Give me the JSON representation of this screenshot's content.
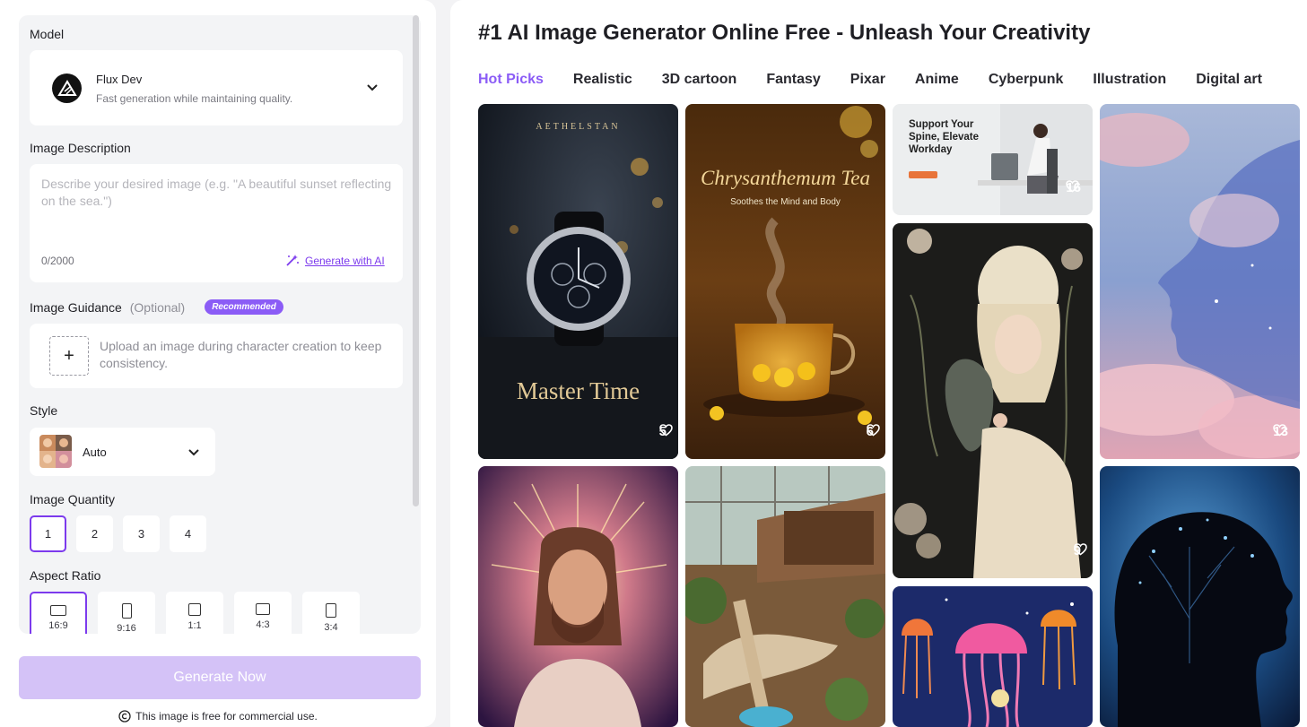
{
  "sidebar": {
    "model_label": "Model",
    "model": {
      "name": "Flux Dev",
      "description": "Fast generation while maintaining quality.",
      "icon": "flux-logo"
    },
    "description_label": "Image Description",
    "description": {
      "placeholder": "Describe your desired image (e.g. \"A beautiful sunset reflecting on the sea.\")",
      "value": "",
      "count": "0/2000",
      "generate_ai_label": "Generate with AI"
    },
    "guidance": {
      "label": "Image Guidance",
      "optional": "(Optional)",
      "badge": "Recommended",
      "upload_text": "Upload an image during character creation to keep consistency."
    },
    "style": {
      "label": "Style",
      "value": "Auto"
    },
    "quantity": {
      "label": "Image Quantity",
      "options": [
        "1",
        "2",
        "3",
        "4"
      ],
      "selected": "1"
    },
    "aspect": {
      "label": "Aspect Ratio",
      "options": [
        "16:9",
        "9:16",
        "1:1",
        "4:3",
        "3:4"
      ],
      "selected": "16:9"
    },
    "generate_button": "Generate Now",
    "free_note": "This image is free for commercial use."
  },
  "main": {
    "title": "#1 AI Image Generator Online Free - Unleash Your Creativity",
    "tabs": [
      "Hot Picks",
      "Realistic",
      "3D cartoon",
      "Fantasy",
      "Pixar",
      "Anime",
      "Cyberpunk",
      "Illustration",
      "Digital art"
    ],
    "active_tab": "Hot Picks",
    "gallery": [
      {
        "name": "watch",
        "likes": "5",
        "texts": [
          "AETHELSTAN",
          "Master Time"
        ]
      },
      {
        "name": "tea",
        "likes": "6",
        "texts": [
          "Chrysanthemum Tea",
          "Soothes the Mind and Body"
        ]
      },
      {
        "name": "spine",
        "likes": "16",
        "texts": [
          "Support Your",
          "Spine, Elevate",
          "Workday"
        ]
      },
      {
        "name": "cloud-face",
        "likes": "13",
        "texts": []
      },
      {
        "name": "dragon-woman",
        "likes": "9",
        "texts": []
      },
      {
        "name": "radiant-man",
        "likes": "",
        "texts": []
      },
      {
        "name": "treehouse",
        "likes": "",
        "texts": []
      },
      {
        "name": "jellyfish",
        "likes": "",
        "texts": []
      },
      {
        "name": "tree-head",
        "likes": "",
        "texts": []
      }
    ]
  },
  "colors": {
    "accent": "#8b5cf6",
    "accent_dark": "#7c3aed",
    "generate_disabled": "#d4c2f7",
    "panel_bg": "#f3f4f6"
  }
}
